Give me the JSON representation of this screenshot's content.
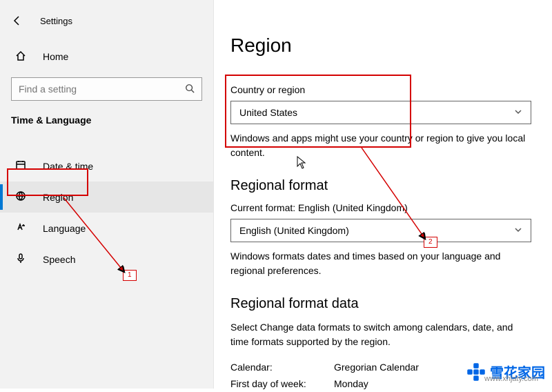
{
  "header": {
    "settings_label": "Settings"
  },
  "sidebar": {
    "home_label": "Home",
    "search_placeholder": "Find a setting",
    "section_title": "Time & Language",
    "items": [
      {
        "label": "Date & time"
      },
      {
        "label": "Region"
      },
      {
        "label": "Language"
      },
      {
        "label": "Speech"
      }
    ]
  },
  "main": {
    "title": "Region",
    "country_section": {
      "label": "Country or region",
      "value": "United States",
      "help": "Windows and apps might use your country or region to give you local content."
    },
    "format_section": {
      "heading": "Regional format",
      "current_label": "Current format: English (United Kingdom)",
      "value": "English (United Kingdom)",
      "help": "Windows formats dates and times based on your language and regional preferences."
    },
    "format_data_section": {
      "heading": "Regional format data",
      "help": "Select Change data formats to switch among calendars, date, and time formats supported by the region.",
      "rows": [
        {
          "k": "Calendar:",
          "v": "Gregorian Calendar"
        },
        {
          "k": "First day of week:",
          "v": "Monday"
        }
      ]
    }
  },
  "annotations": {
    "callout1": "1",
    "callout2": "2"
  },
  "watermark": {
    "brand": "雪花家园",
    "url": "www.xhjaty.com"
  }
}
